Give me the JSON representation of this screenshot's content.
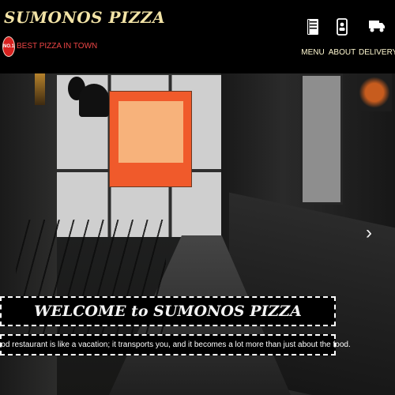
{
  "brand": {
    "title": "SUMONOS PIZZA",
    "badge_text": "NO.1",
    "tagline": "BEST PIZZA IN TOWN"
  },
  "nav": {
    "items": [
      {
        "label": "MENU",
        "icon": "menu-book-icon"
      },
      {
        "label": "ABOUT",
        "icon": "about-phone-icon"
      },
      {
        "label": "DELIVERY",
        "icon": "truck-icon"
      }
    ]
  },
  "hero": {
    "background": "restaurant-interior-photo",
    "carousel_next": "›"
  },
  "welcome": {
    "title": "WELCOME to SUMONOS PIZZA",
    "subtitle": "A good restaurant is like a vacation; it transports you, and it becomes a lot more than just about the food."
  },
  "colors": {
    "header_bg": "#000000",
    "title": "#f2e3a6",
    "tagline": "#ee4545",
    "nav_label": "#fff8d0",
    "badge": "#d8211f"
  }
}
